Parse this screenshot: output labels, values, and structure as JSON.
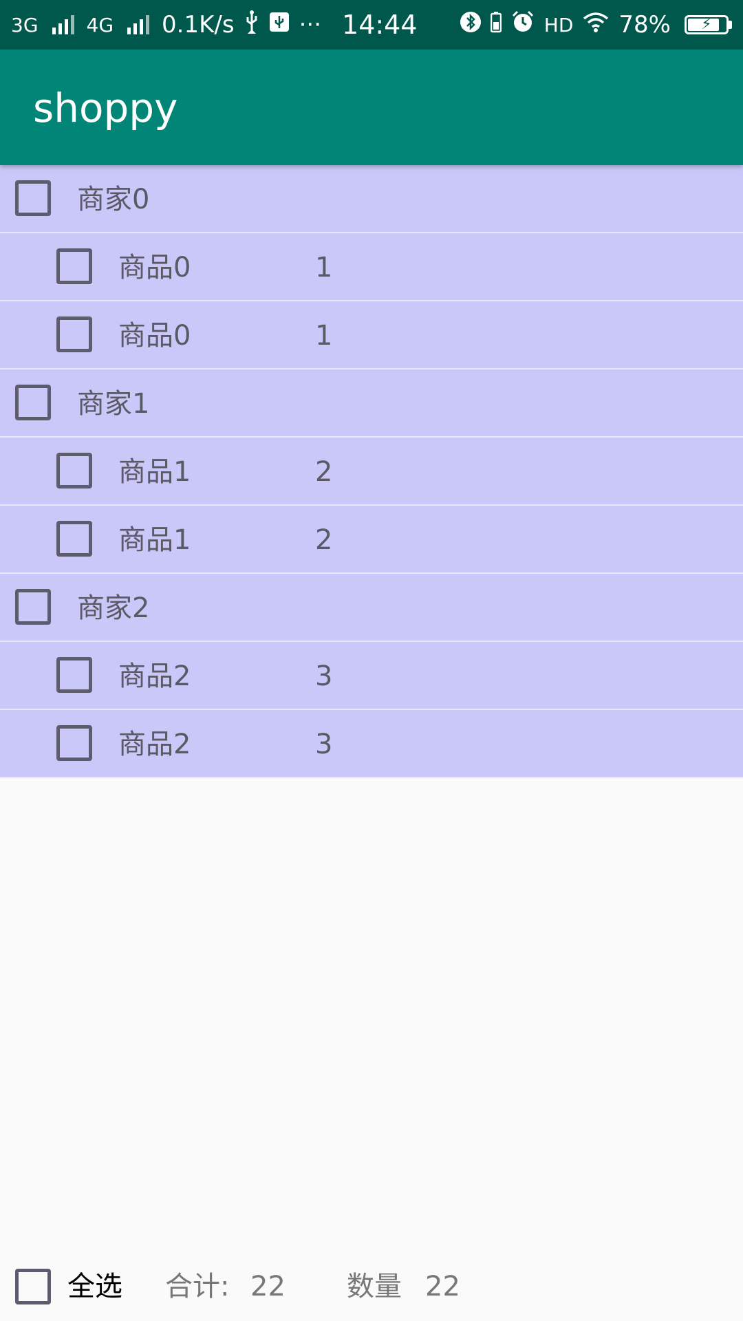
{
  "status_bar": {
    "net1_label": "3G",
    "net2_label": "4G",
    "speed": "0.1K/s",
    "more": "···",
    "time": "14:44",
    "hd": "HD",
    "battery": "78%",
    "icons": [
      "signal-icon",
      "usb-icon",
      "usb-debug-icon",
      "bluetooth-icon",
      "vibrate-icon",
      "alarm-icon",
      "wifi-icon",
      "battery-charging-icon"
    ]
  },
  "app_bar": {
    "title": "shoppy",
    "color": "#008577"
  },
  "list": {
    "rows": [
      {
        "type": "merchant",
        "label": "商家0",
        "checked": false
      },
      {
        "type": "product",
        "label": "商品0",
        "count": "1",
        "checked": false
      },
      {
        "type": "product",
        "label": "商品0",
        "count": "1",
        "checked": false
      },
      {
        "type": "merchant",
        "label": "商家1",
        "checked": false
      },
      {
        "type": "product",
        "label": "商品1",
        "count": "2",
        "checked": false
      },
      {
        "type": "product",
        "label": "商品1",
        "count": "2",
        "checked": false
      },
      {
        "type": "merchant",
        "label": "商家2",
        "checked": false
      },
      {
        "type": "product",
        "label": "商品2",
        "count": "3",
        "checked": false
      },
      {
        "type": "product",
        "label": "商品2",
        "count": "3",
        "checked": false
      }
    ],
    "row_color": "#cac8f9"
  },
  "bottom_bar": {
    "select_all_label": "全选",
    "select_all_checked": false,
    "total_label": "合计:",
    "total_value": "22",
    "quantity_label": "数量",
    "quantity_value": "22"
  }
}
